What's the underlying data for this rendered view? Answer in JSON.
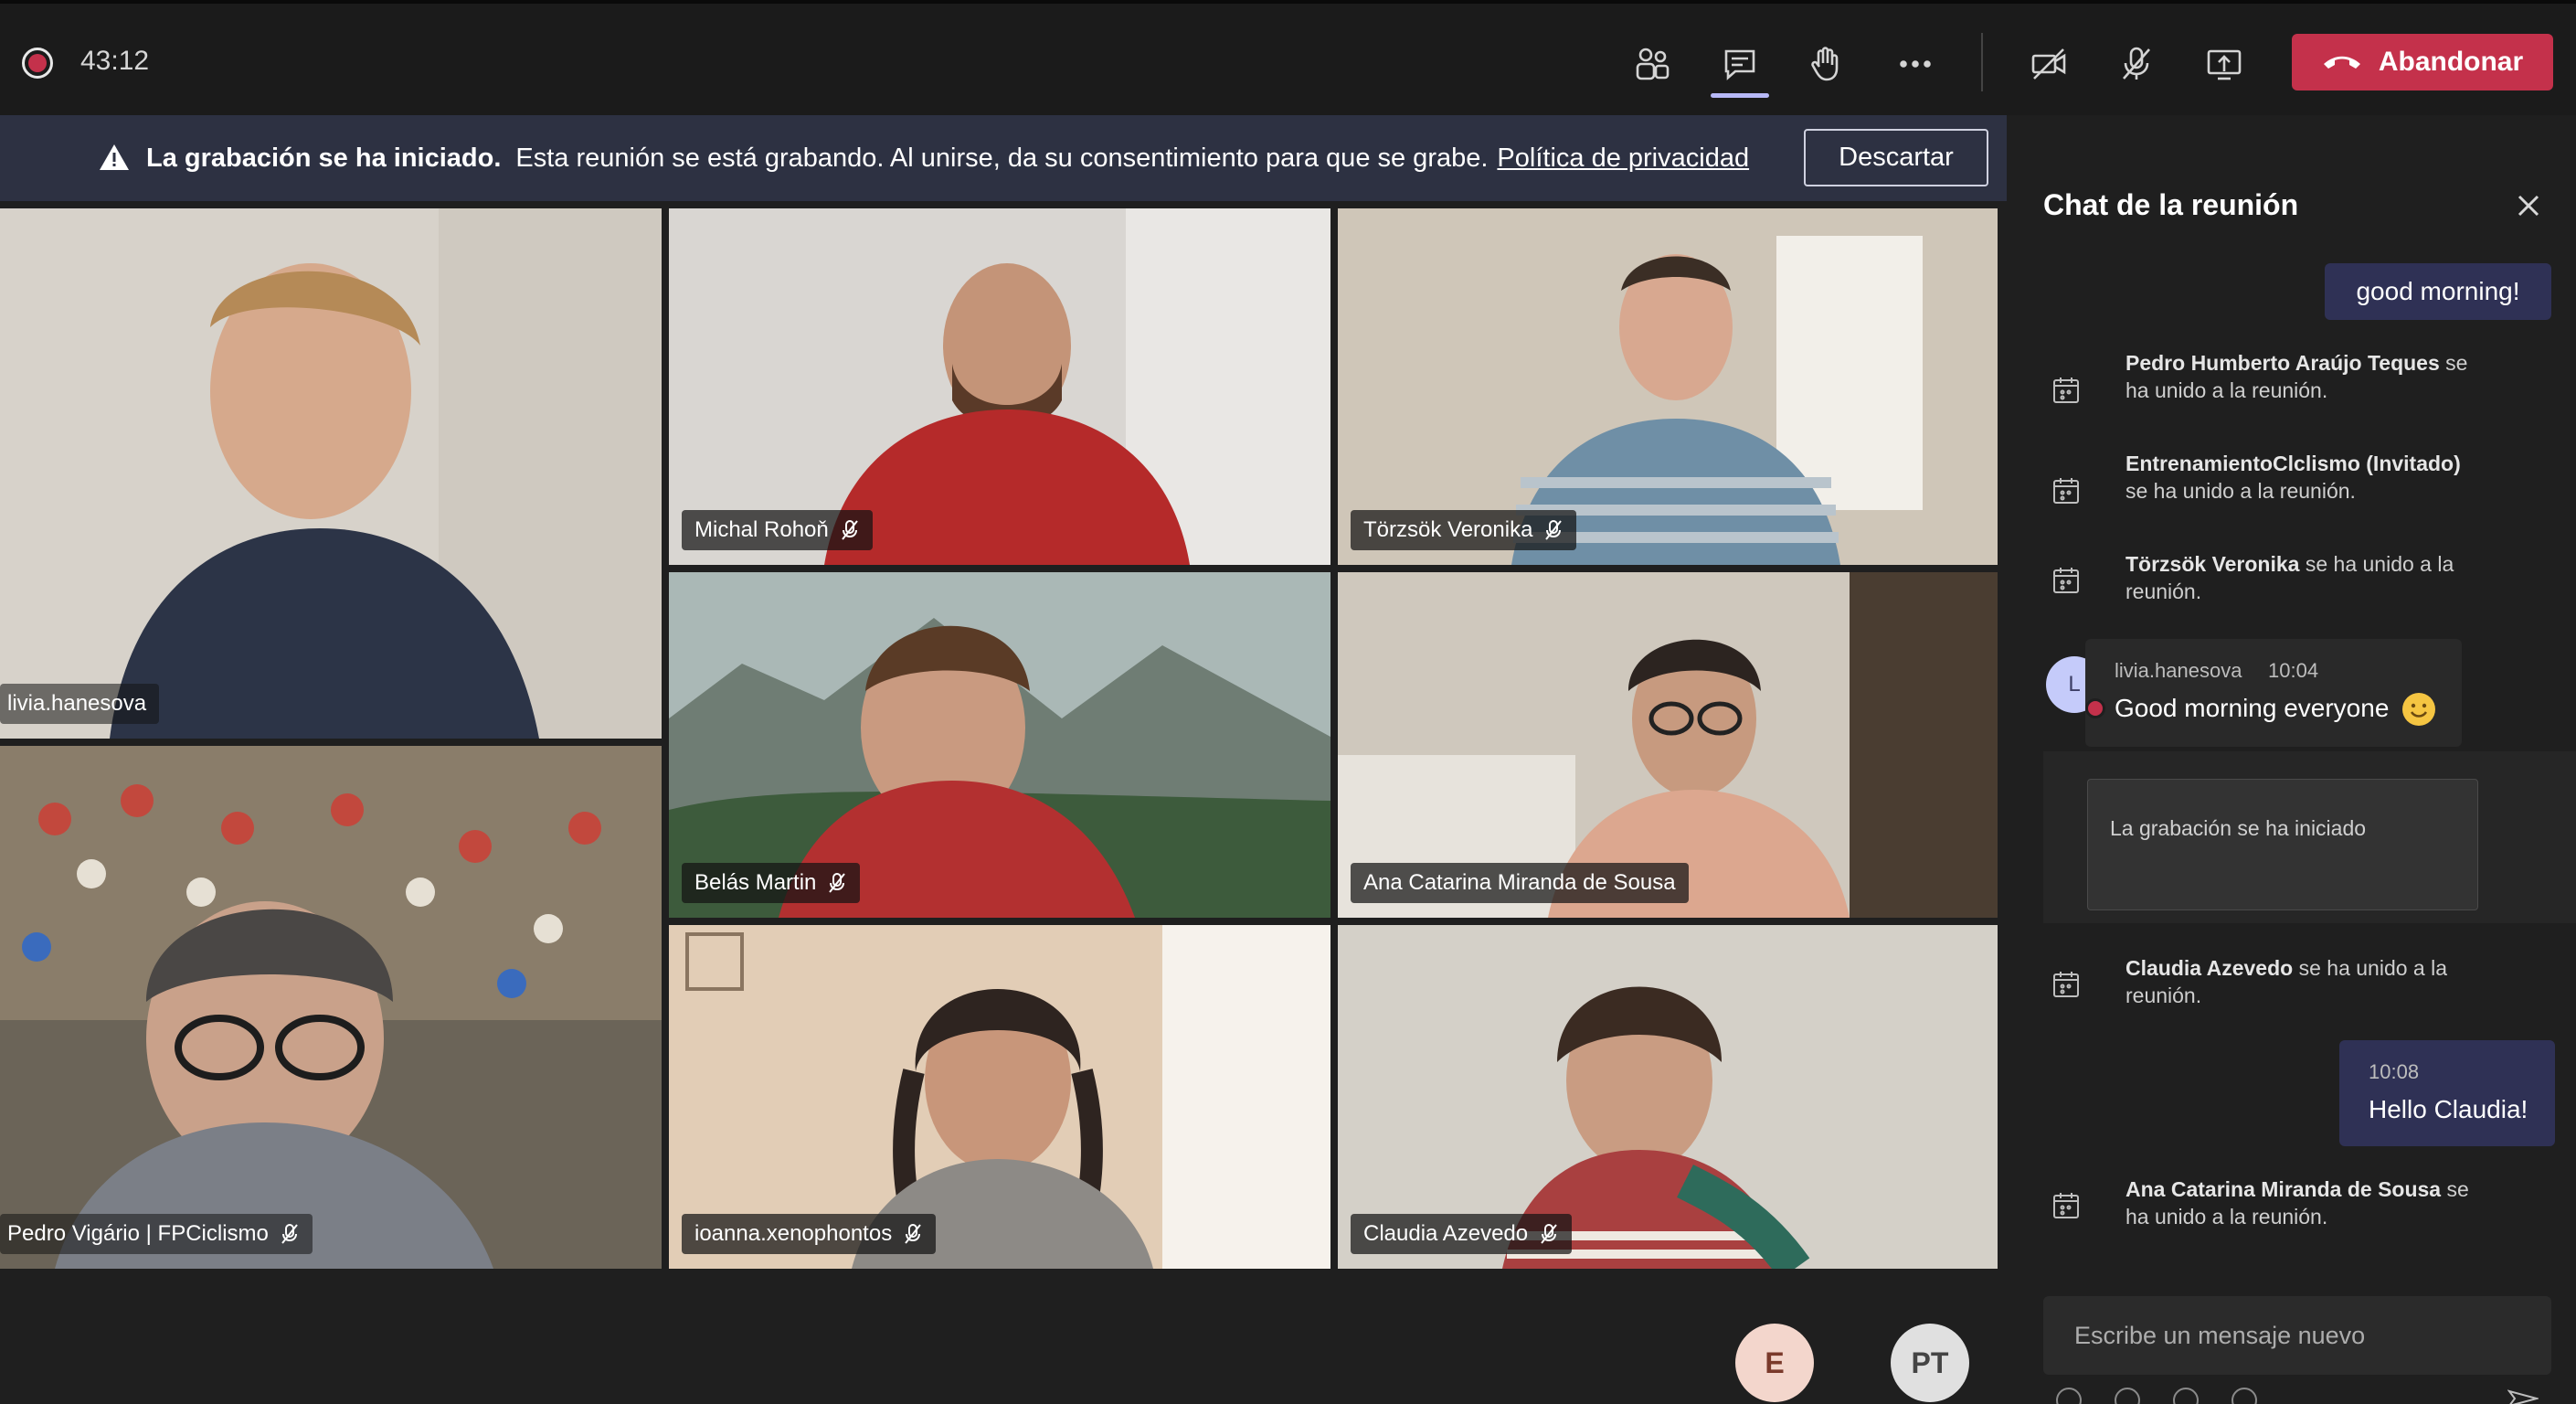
{
  "topbar": {
    "timer": "43:12",
    "icons": [
      "participants-icon",
      "chat-icon",
      "raise-hand-icon",
      "more-options-icon",
      "camera-off-icon",
      "mic-off-icon",
      "share-screen-icon"
    ],
    "leave_label": "Abandonar",
    "leave_color": "#c4314b"
  },
  "banner": {
    "title": "La grabación se ha iniciado.",
    "text": "Esta reunión se está grabando. Al unirse, da su consentimiento para que se grabe.",
    "link": "Política de privacidad",
    "dismiss_label": "Descartar"
  },
  "participants": [
    {
      "name": "livia.hanesova",
      "muted": false
    },
    {
      "name": "Michal Rohoň",
      "muted": true
    },
    {
      "name": "Törzsök Veronika",
      "muted": true
    },
    {
      "name": "Belás Martin",
      "muted": true
    },
    {
      "name": "Ana Catarina Miranda de Sousa",
      "muted": false
    },
    {
      "name": "Pedro Vigário | FPCiclismo",
      "muted": true
    },
    {
      "name": "ioanna.xenophontos",
      "muted": true
    },
    {
      "name": "Claudia Azevedo",
      "muted": true
    }
  ],
  "overflow_avatars": [
    "E",
    "PT"
  ],
  "chat": {
    "title": "Chat de la reunión",
    "my_first_message": "good morning!",
    "system_1_name": "Pedro Humberto Araújo Teques",
    "system_1_text": "se ha unido a la reunión.",
    "system_2_name": "EntrenamientoClclismo (Invitado)",
    "system_2_text": "se ha unido a la reunión.",
    "system_3_name": "Törzsök Veronika",
    "system_3_text": "se ha unido a la reunión.",
    "incoming": {
      "avatar_initial": "L",
      "sender": "livia.hanesova",
      "time": "10:04",
      "text": "Good morning everyone"
    },
    "recording_card": "La grabación se ha iniciado",
    "system_4_name": "Claudia Azevedo",
    "system_4_text": "se ha unido a la reunión.",
    "my_second_time": "10:08",
    "my_second_message": "Hello Claudia!",
    "system_5_name": "Ana Catarina Miranda de Sousa",
    "system_5_text": "se ha unido a la reunión.",
    "compose_placeholder": "Escribe un mensaje nuevo"
  }
}
